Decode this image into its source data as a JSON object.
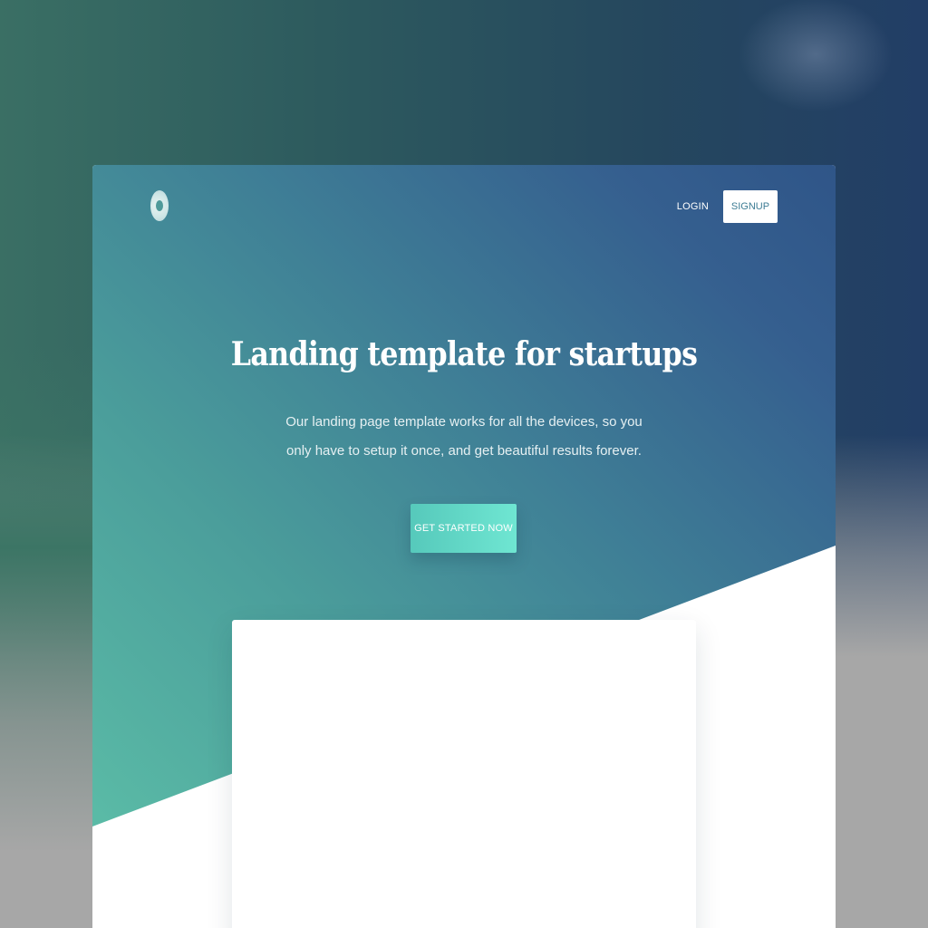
{
  "nav": {
    "login_label": "LOGIN",
    "signup_label": "SIGNUP"
  },
  "hero": {
    "title": "Landing template for startups",
    "subtitle": "Our landing page template works for all the devices, so you only have to setup it once, and get beautiful results forever.",
    "cta_label": "GET STARTED NOW"
  },
  "colors": {
    "gradient_start": "#5ec2a9",
    "gradient_end": "#2f5588",
    "cta_start": "#56c9bb",
    "cta_end": "#6fe6d2",
    "signup_text": "#3d7c94"
  },
  "icons": {
    "logo": "logo-icon"
  }
}
